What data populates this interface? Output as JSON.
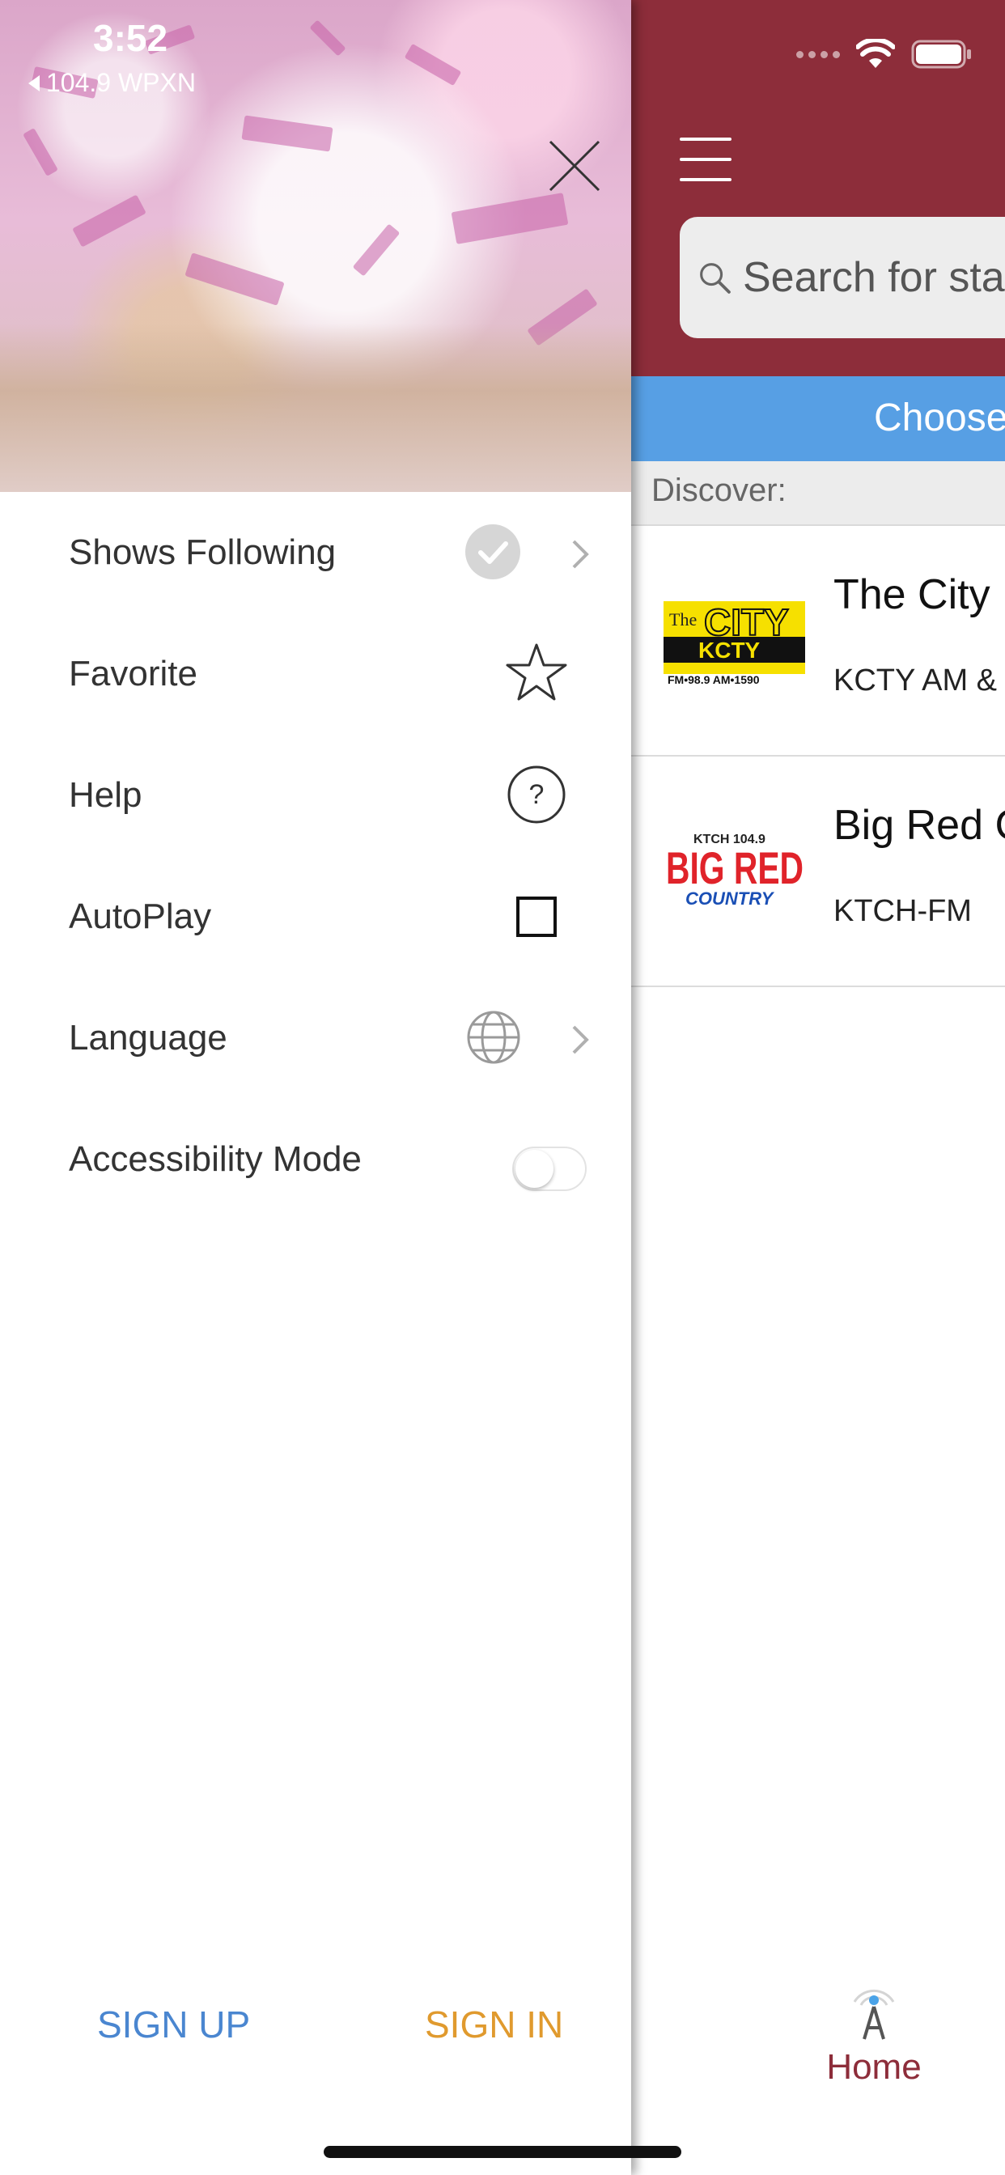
{
  "status_bar": {
    "time": "3:52",
    "back_app": "104.9 WPXN"
  },
  "drawer": {
    "menu_items": [
      {
        "label": "Shows Following",
        "icon": "check-circle-icon"
      },
      {
        "label": "Favorite",
        "icon": "star-icon"
      },
      {
        "label": "Help",
        "icon": "question-circle-icon"
      },
      {
        "label": "AutoPlay",
        "icon": "checkbox-icon"
      },
      {
        "label": "Language",
        "icon": "globe-icon"
      },
      {
        "label": "Accessibility Mode",
        "icon": "toggle-switch"
      }
    ],
    "autoplay_checked": false,
    "accessibility_mode_on": false,
    "signup_label": "SIGN UP",
    "signin_label": "SIGN IN"
  },
  "main": {
    "search_placeholder": "Search for sta",
    "choose_label": "Choose",
    "discover_label": "Discover:",
    "stations": [
      {
        "name": "The City",
        "call_sign": "KCTY AM &",
        "logo_text": "The CITY KCTY"
      },
      {
        "name": "Big Red C",
        "call_sign": "KTCH-FM",
        "logo_text": "KTCH 104.9 BIG RED COUNTRY"
      }
    ],
    "home_tab_label": "Home"
  },
  "colors": {
    "header": "#8d2d3a",
    "choose_bar": "#579fe4",
    "signup": "#4a86d0",
    "signin": "#e09a2e"
  }
}
